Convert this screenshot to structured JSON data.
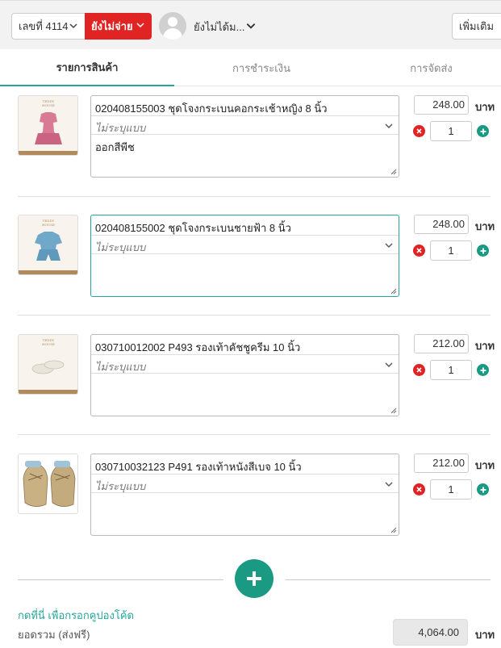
{
  "topbar": {
    "order_label": "เลขที่ 4114",
    "status_label": "ยังไม่จ่าย",
    "customer_label": "ยังไม่ได้ม...",
    "more_label": "เพิ่มเติม"
  },
  "tabs": [
    {
      "label": "รายการสินค้า"
    },
    {
      "label": "การชำระเงิน"
    },
    {
      "label": "การจัดส่ง"
    }
  ],
  "items": [
    {
      "name": "020408155003 ชุดโจงกระเบนคอกระเช้าหญิง 8 นิ้ว",
      "variant_placeholder": "ไม่ระบุแบบ",
      "note": "ออกสีพีช",
      "price": "248.00",
      "qty": "1",
      "thumb": "pink-dress-thumbnail"
    },
    {
      "name": "020408155002 ชุดโจงกระเบนชายฟ้า 8 นิ้ว",
      "variant_placeholder": "ไม่ระบุแบบ",
      "note": "",
      "price": "248.00",
      "qty": "1",
      "thumb": "blue-outfit-thumbnail"
    },
    {
      "name": "030710012002 P493 รองเท้าคัชชูครีม 10 นิ้ว",
      "variant_placeholder": "ไม่ระบุแบบ",
      "note": "",
      "price": "212.00",
      "qty": "1",
      "thumb": "cream-shoe-thumbnail"
    },
    {
      "name": "030710032123 P491 รองเท้าหนังสีเบจ 10 นิ้ว",
      "variant_placeholder": "ไม่ระบุแบบ",
      "note": "",
      "price": "212.00",
      "qty": "1",
      "thumb": "beige-shoe-thumbnail"
    }
  ],
  "currency": "บาท",
  "coupon_link": "กดที่นี่ เพื่อกรอกคูปองโค้ด",
  "total": {
    "label": "ยอดรวม (ส่งฟรี)",
    "value": "4,064.00"
  },
  "colors": {
    "accent": "#1a9a82",
    "danger": "#e02424"
  },
  "thumb_brand": "TEDDY HOUSE"
}
